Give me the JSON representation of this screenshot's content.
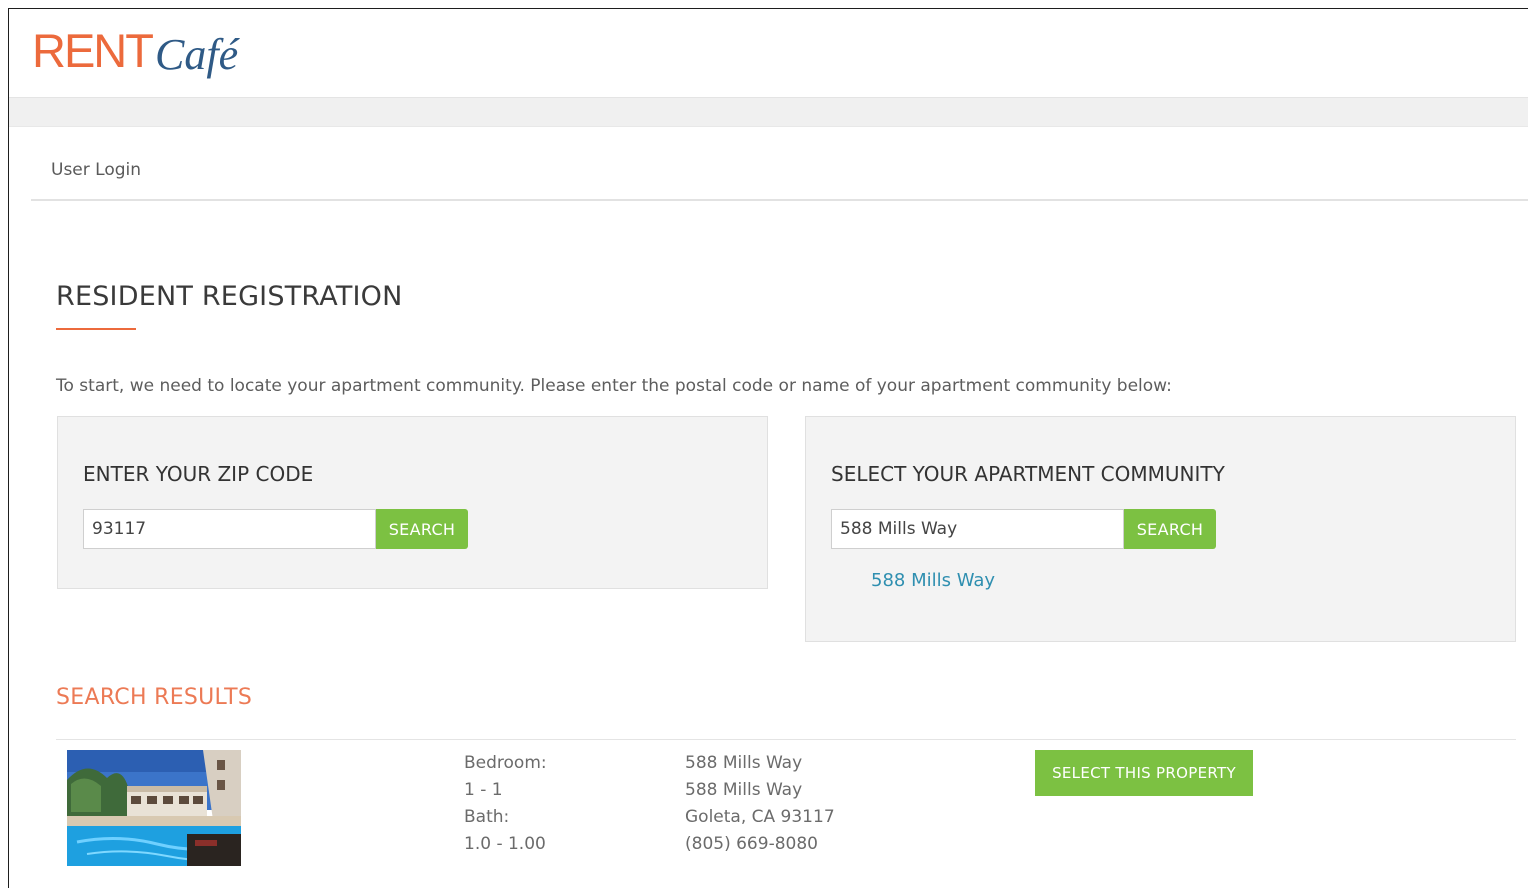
{
  "brand": {
    "rent": "RENT",
    "cafe": "Café"
  },
  "breadcrumb": "User Login",
  "page_title": "RESIDENT REGISTRATION",
  "intro_text": "To start, we need to locate your apartment community. Please enter the postal code or name of your apartment community below:",
  "zip_panel": {
    "heading": "ENTER YOUR ZIP CODE",
    "value": "93117",
    "button": "SEARCH"
  },
  "community_panel": {
    "heading": "SELECT YOUR APARTMENT COMMUNITY",
    "value": "588 Mills Way",
    "button": "SEARCH",
    "suggestion": "588 Mills Way"
  },
  "results": {
    "title": "SEARCH RESULTS",
    "items": [
      {
        "bedroom_label": "Bedroom:",
        "bedroom_value": "1 - 1",
        "bath_label": "Bath:",
        "bath_value": "1.0 - 1.00",
        "name": "588 Mills Way",
        "street": "588 Mills Way",
        "city": "Goleta, CA 93117",
        "phone": "(805) 669-8080",
        "button": "SELECT THIS PROPERTY"
      }
    ]
  },
  "colors": {
    "brand_orange": "#ec6a3c",
    "brand_blue": "#2f5a86",
    "button_green": "#7cc142",
    "link_blue": "#2f8fb0"
  },
  "icons": {
    "property_photo": "pool-photo-thumbnail"
  }
}
